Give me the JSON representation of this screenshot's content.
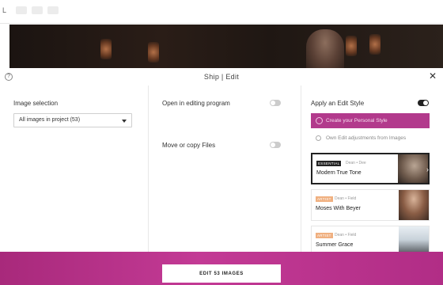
{
  "app": {
    "user_initial": "L",
    "header_icons": [
      "app-menu-icon",
      "filter-icon",
      "grid-icon"
    ]
  },
  "dialog": {
    "title": "Ship | Edit",
    "help_icon": "help-icon",
    "close_icon": "close-icon",
    "close_glyph": "✕"
  },
  "image_selection": {
    "label": "Image selection",
    "selected": "All images in project (53)"
  },
  "open_in_editing": {
    "label": "Open in editing program",
    "enabled": false
  },
  "move_copy": {
    "label": "Move or copy Files",
    "enabled": false
  },
  "edit_style": {
    "label": "Apply an Edit Style",
    "enabled": true,
    "create_label": "Create your Personal Style",
    "own_label": "Own Edit adjustments from Images",
    "styles": [
      {
        "badge": "ESSENTIAL",
        "author": "Dean • Dee",
        "name": "Modern True Tone",
        "selected": true
      },
      {
        "badge": "ARTIST",
        "author": "Dean • Field",
        "name": "Moses With Beyer",
        "selected": false
      },
      {
        "badge": "ARTIST",
        "author": "Dean • Field",
        "name": "Summer Grace",
        "selected": false
      }
    ]
  },
  "footer": {
    "edit_button": "EDIT 53 IMAGES"
  },
  "colors": {
    "accent": "#b23a8c",
    "peach_badge": "#f0b080"
  }
}
